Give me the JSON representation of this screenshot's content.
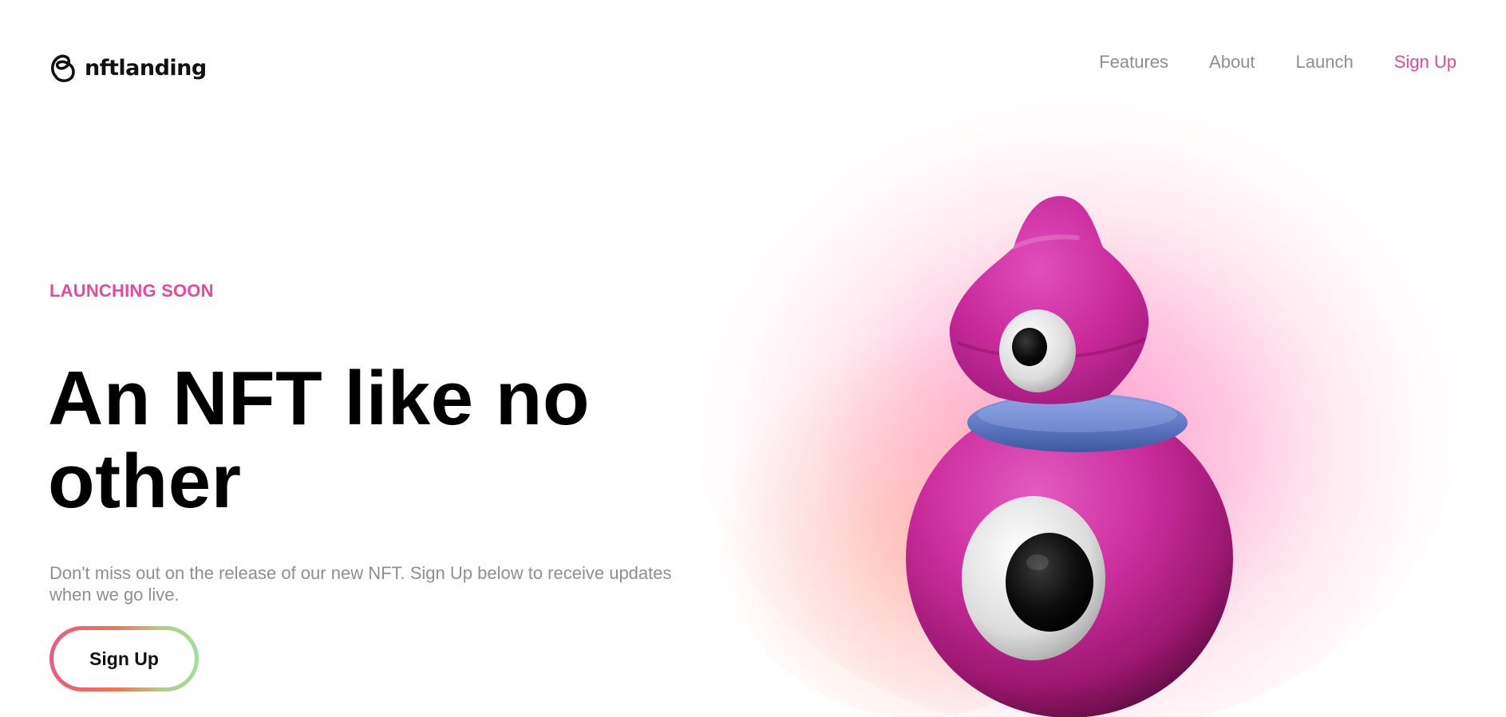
{
  "brand": {
    "name": "nftlanding",
    "icon": "loop-logo-icon"
  },
  "nav": {
    "items": [
      {
        "label": "Features"
      },
      {
        "label": "About"
      },
      {
        "label": "Launch"
      },
      {
        "label": "Sign Up"
      }
    ]
  },
  "hero": {
    "eyebrow": "LAUNCHING SOON",
    "headline": "An NFT like no other",
    "subtext": "Don't miss out on the release of our new NFT. Sign Up below to receive updates when we go live.",
    "cta_label": "Sign Up",
    "image": "pink-one-eyed-creature-nft"
  },
  "colors": {
    "accent": "#e8489a",
    "nav_text": "#8f8f8f",
    "headline": "#000000",
    "cta_gradient": [
      "#e85a86",
      "#f07550",
      "#9fe09a"
    ]
  }
}
